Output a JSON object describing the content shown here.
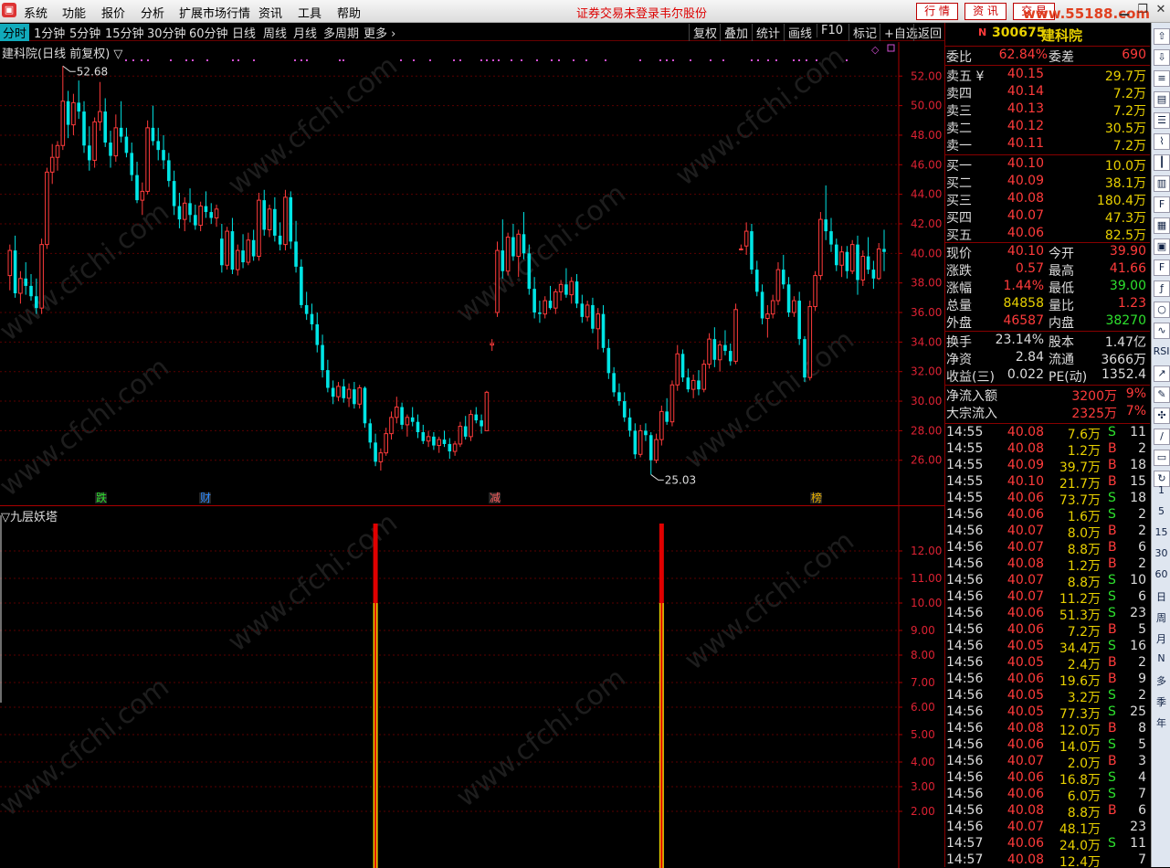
{
  "menu": {
    "items": [
      "系统",
      "功能",
      "报价",
      "分析",
      "扩展市场行情",
      "资讯",
      "工具",
      "帮助"
    ],
    "warning": "证券交易未登录",
    "broker": "韦尔股份",
    "tabs": [
      "行 情",
      "资 讯",
      "交 易"
    ],
    "watermark_site": "www.55188.com"
  },
  "periods": {
    "items": [
      "分时",
      "1分钟",
      "5分钟",
      "15分钟",
      "30分钟",
      "60分钟",
      "日线",
      "周线",
      "月线",
      "多周期",
      "更多 ›"
    ],
    "active": "分时",
    "right": [
      "复权",
      "叠加",
      "统计",
      "画线",
      "F10",
      "标记",
      "+自选",
      "返回"
    ]
  },
  "main_chart": {
    "title": "建科院(日线 前复权) ▽",
    "high_label": "52.68",
    "low_label": "25.03",
    "events": [
      "跌",
      "财",
      "减",
      "榜"
    ],
    "y_ticks": [
      "52.00",
      "50.00",
      "48.00",
      "46.00",
      "44.00",
      "42.00",
      "40.00",
      "38.00",
      "36.00",
      "34.00",
      "32.00",
      "30.00",
      "28.00",
      "26.00"
    ]
  },
  "indicator": {
    "title": "▽九层妖塔",
    "y_ticks": [
      "12.00",
      "11.00",
      "10.00",
      "9.00",
      "8.00",
      "7.00",
      "6.00",
      "5.00",
      "4.00",
      "3.00",
      "2.00"
    ]
  },
  "chart_data": {
    "type": "candlestick",
    "title": "建科院(日线 前复权)",
    "ylim": [
      24.5,
      53.5
    ],
    "grid": true,
    "annotations": {
      "high": 52.68,
      "low": 25.03
    },
    "candles": [
      [
        38.5,
        40.6,
        37.5,
        40.2
      ],
      [
        40.2,
        41.2,
        37.0,
        37.3
      ],
      [
        37.3,
        38.8,
        36.6,
        38.3
      ],
      [
        38.3,
        39.4,
        37.2,
        37.8
      ],
      [
        37.8,
        38.6,
        36.8,
        37.1
      ],
      [
        37.1,
        38.3,
        35.9,
        36.3
      ],
      [
        36.3,
        41.0,
        35.9,
        40.6
      ],
      [
        40.6,
        45.8,
        40.3,
        45.5
      ],
      [
        45.5,
        47.4,
        44.7,
        46.5
      ],
      [
        46.5,
        47.6,
        45.6,
        47.3
      ],
      [
        47.3,
        52.68,
        47.0,
        50.3
      ],
      [
        50.3,
        51.0,
        47.8,
        48.7
      ],
      [
        48.7,
        50.8,
        48.0,
        50.2
      ],
      [
        50.2,
        51.7,
        49.1,
        49.6
      ],
      [
        49.6,
        50.3,
        46.8,
        47.3
      ],
      [
        47.3,
        48.6,
        45.6,
        46.3
      ],
      [
        46.3,
        49.2,
        45.8,
        48.9
      ],
      [
        48.9,
        51.6,
        48.3,
        49.6
      ],
      [
        49.6,
        50.5,
        47.2,
        47.5
      ],
      [
        47.5,
        48.3,
        45.8,
        46.6
      ],
      [
        46.6,
        49.4,
        46.2,
        48.5
      ],
      [
        48.5,
        50.3,
        47.5,
        47.9
      ],
      [
        47.9,
        48.5,
        46.5,
        46.8
      ],
      [
        46.8,
        47.5,
        44.9,
        45.3
      ],
      [
        45.3,
        46.2,
        43.4,
        43.6
      ],
      [
        43.6,
        44.8,
        42.6,
        44.2
      ],
      [
        44.2,
        49.0,
        44.0,
        48.5
      ],
      [
        48.5,
        50.0,
        47.3,
        47.6
      ],
      [
        47.6,
        48.5,
        46.3,
        47.0
      ],
      [
        47.0,
        48.0,
        45.7,
        46.3
      ],
      [
        46.3,
        46.8,
        44.5,
        44.9
      ],
      [
        44.9,
        45.6,
        42.6,
        43.2
      ],
      [
        43.2,
        44.1,
        41.7,
        42.3
      ],
      [
        42.3,
        43.8,
        41.5,
        43.4
      ],
      [
        43.4,
        44.4,
        42.1,
        42.6
      ],
      [
        42.6,
        43.3,
        41.6,
        41.9
      ],
      [
        41.9,
        43.5,
        41.5,
        43.2
      ],
      [
        43.2,
        44.2,
        42.4,
        42.8
      ],
      [
        42.8,
        43.4,
        42.0,
        42.4
      ],
      [
        42.4,
        43.3,
        41.8,
        43.0
      ],
      [
        41.0,
        42.0,
        38.7,
        39.2
      ],
      [
        39.2,
        41.8,
        38.9,
        41.5
      ],
      [
        41.5,
        42.4,
        38.6,
        38.9
      ],
      [
        38.9,
        40.6,
        38.5,
        40.2
      ],
      [
        40.2,
        41.3,
        39.0,
        39.4
      ],
      [
        39.4,
        41.4,
        39.2,
        40.9
      ],
      [
        40.9,
        41.6,
        39.5,
        39.8
      ],
      [
        39.8,
        44.1,
        39.5,
        43.6
      ],
      [
        43.6,
        44.3,
        41.2,
        41.6
      ],
      [
        41.6,
        43.3,
        41.1,
        43.0
      ],
      [
        43.0,
        43.8,
        40.8,
        41.2
      ],
      [
        41.2,
        42.1,
        40.2,
        40.6
      ],
      [
        40.6,
        44.3,
        40.2,
        43.8
      ],
      [
        43.8,
        44.2,
        40.3,
        40.8
      ],
      [
        40.8,
        42.2,
        38.7,
        39.1
      ],
      [
        39.1,
        39.6,
        36.3,
        36.5
      ],
      [
        36.5,
        37.4,
        35.5,
        35.9
      ],
      [
        35.9,
        36.6,
        34.8,
        35.2
      ],
      [
        35.2,
        36.0,
        33.3,
        33.8
      ],
      [
        33.8,
        34.5,
        31.6,
        32.1
      ],
      [
        32.1,
        32.8,
        30.6,
        30.9
      ],
      [
        30.9,
        31.4,
        29.8,
        30.3
      ],
      [
        30.3,
        31.3,
        30.0,
        31.0
      ],
      [
        31.0,
        31.5,
        29.9,
        30.2
      ],
      [
        30.2,
        31.2,
        29.6,
        30.8
      ],
      [
        30.8,
        31.3,
        29.5,
        29.8
      ],
      [
        29.8,
        31.1,
        29.5,
        30.9
      ],
      [
        30.9,
        31.0,
        28.2,
        28.5
      ],
      [
        28.5,
        28.8,
        26.8,
        27.2
      ],
      [
        27.2,
        27.8,
        25.6,
        25.9
      ],
      [
        25.9,
        26.8,
        25.3,
        26.5
      ],
      [
        26.5,
        28.2,
        26.3,
        27.8
      ],
      [
        27.8,
        29.3,
        27.4,
        28.9
      ],
      [
        28.9,
        30.3,
        28.5,
        29.6
      ],
      [
        29.6,
        29.9,
        28.1,
        28.4
      ],
      [
        28.4,
        29.1,
        27.6,
        28.9
      ],
      [
        28.9,
        29.6,
        28.3,
        28.6
      ],
      [
        28.6,
        29.1,
        27.5,
        27.9
      ],
      [
        27.9,
        28.4,
        27.1,
        27.3
      ],
      [
        27.3,
        28.0,
        26.9,
        27.6
      ],
      [
        27.6,
        27.9,
        26.7,
        27.0
      ],
      [
        27.0,
        27.6,
        26.5,
        27.4
      ],
      [
        27.4,
        28.0,
        26.9,
        27.1
      ],
      [
        27.1,
        27.5,
        26.1,
        26.6
      ],
      [
        26.6,
        27.3,
        26.3,
        27.1
      ],
      [
        27.1,
        28.6,
        26.9,
        28.3
      ],
      [
        28.3,
        29.0,
        27.4,
        27.6
      ],
      [
        27.6,
        29.4,
        27.3,
        29.1
      ],
      [
        29.1,
        29.6,
        28.5,
        28.7
      ],
      [
        28.7,
        29.1,
        27.8,
        28.3
      ],
      [
        28.0,
        30.7,
        28.1,
        30.6
      ],
      [
        33.8,
        34.2,
        33.4,
        33.9
      ],
      [
        36.0,
        40.8,
        35.7,
        40.2
      ],
      [
        40.2,
        42.3,
        38.3,
        38.8
      ],
      [
        38.8,
        41.4,
        38.5,
        41.1
      ],
      [
        41.1,
        42.0,
        39.5,
        39.8
      ],
      [
        39.8,
        41.6,
        38.4,
        41.3
      ],
      [
        41.3,
        42.8,
        39.6,
        40.0
      ],
      [
        40.0,
        40.6,
        37.2,
        37.6
      ],
      [
        37.6,
        38.4,
        35.6,
        36.0
      ],
      [
        36.0,
        36.8,
        35.3,
        35.9
      ],
      [
        35.9,
        37.1,
        35.6,
        36.8
      ],
      [
        36.8,
        37.8,
        36.2,
        36.3
      ],
      [
        36.3,
        37.6,
        35.9,
        37.4
      ],
      [
        37.4,
        38.2,
        36.8,
        37.9
      ],
      [
        37.9,
        39.0,
        37.0,
        37.2
      ],
      [
        37.2,
        38.4,
        36.6,
        38.1
      ],
      [
        38.1,
        38.6,
        36.3,
        36.6
      ],
      [
        36.6,
        37.2,
        35.3,
        35.7
      ],
      [
        35.7,
        36.8,
        35.4,
        36.5
      ],
      [
        36.5,
        37.0,
        34.6,
        34.9
      ],
      [
        34.9,
        36.3,
        33.5,
        35.9
      ],
      [
        35.9,
        36.5,
        33.3,
        33.6
      ],
      [
        33.6,
        34.2,
        31.5,
        31.9
      ],
      [
        31.9,
        32.3,
        30.3,
        30.6
      ],
      [
        30.6,
        31.2,
        29.7,
        30.0
      ],
      [
        30.0,
        30.6,
        28.6,
        28.9
      ],
      [
        28.9,
        29.5,
        27.6,
        28.0
      ],
      [
        28.0,
        28.5,
        26.1,
        26.4
      ],
      [
        26.4,
        28.4,
        26.2,
        28.0
      ],
      [
        28.0,
        28.5,
        27.3,
        27.7
      ],
      [
        27.7,
        27.9,
        25.03,
        26.0
      ],
      [
        26.0,
        27.8,
        25.8,
        27.4
      ],
      [
        27.4,
        29.7,
        27.0,
        29.3
      ],
      [
        29.3,
        30.2,
        28.4,
        28.6
      ],
      [
        28.6,
        31.4,
        28.3,
        31.1
      ],
      [
        31.1,
        33.8,
        30.7,
        33.2
      ],
      [
        33.2,
        33.5,
        31.3,
        31.6
      ],
      [
        31.6,
        32.2,
        30.6,
        30.8
      ],
      [
        30.8,
        31.8,
        30.2,
        31.4
      ],
      [
        31.4,
        32.1,
        30.4,
        30.8
      ],
      [
        30.8,
        32.8,
        30.6,
        32.5
      ],
      [
        32.5,
        34.6,
        32.2,
        34.2
      ],
      [
        34.2,
        35.0,
        32.3,
        32.8
      ],
      [
        32.8,
        34.1,
        32.0,
        33.8
      ],
      [
        33.8,
        34.8,
        33.1,
        33.4
      ],
      [
        33.4,
        33.9,
        32.4,
        32.7
      ],
      [
        32.7,
        36.6,
        32.5,
        36.2
      ],
      [
        40.3,
        40.6,
        40.2,
        40.3
      ],
      [
        40.5,
        42.1,
        39.9,
        41.5
      ],
      [
        41.5,
        42.0,
        38.6,
        38.9
      ],
      [
        38.9,
        39.5,
        37.1,
        37.4
      ],
      [
        37.4,
        37.9,
        35.2,
        35.6
      ],
      [
        35.6,
        36.5,
        34.3,
        35.9
      ],
      [
        35.9,
        37.2,
        35.6,
        36.8
      ],
      [
        36.8,
        39.4,
        36.5,
        38.9
      ],
      [
        38.9,
        39.9,
        37.6,
        37.9
      ],
      [
        37.9,
        38.4,
        35.7,
        36.0
      ],
      [
        36.0,
        37.1,
        35.7,
        36.8
      ],
      [
        36.8,
        37.4,
        33.8,
        34.2
      ],
      [
        34.2,
        34.4,
        31.3,
        31.6
      ],
      [
        31.6,
        36.8,
        31.4,
        36.4
      ],
      [
        36.4,
        38.8,
        36.1,
        38.5
      ],
      [
        38.5,
        42.8,
        38.2,
        42.3
      ],
      [
        42.3,
        44.6,
        40.9,
        41.5
      ],
      [
        41.5,
        42.4,
        40.1,
        40.6
      ],
      [
        40.6,
        41.0,
        38.8,
        39.2
      ],
      [
        39.2,
        40.5,
        38.4,
        40.1
      ],
      [
        40.1,
        40.5,
        38.3,
        38.8
      ],
      [
        38.8,
        40.9,
        38.6,
        40.6
      ],
      [
        40.6,
        41.2,
        37.2,
        38.2
      ],
      [
        38.2,
        40.2,
        37.8,
        39.8
      ],
      [
        39.8,
        41.1,
        38.6,
        38.9
      ],
      [
        38.9,
        39.5,
        37.6,
        38.3
      ],
      [
        38.3,
        40.7,
        38.2,
        40.3
      ],
      [
        40.3,
        41.6,
        38.8,
        40.1
      ]
    ],
    "indicator_series": {
      "name": "九层妖塔",
      "ylim": [
        0.5,
        13.0
      ],
      "signals": [
        {
          "index": 69,
          "value": 13.0,
          "base": 10.0
        },
        {
          "index": 123,
          "value": 13.0,
          "base": 10.0
        }
      ]
    }
  },
  "quote": {
    "code": "300675",
    "name": "建科院",
    "market_icon": "N",
    "weibi_label": "委比",
    "weibi": "62.84%",
    "weicha_label": "委差",
    "weicha": "690",
    "asks": [
      {
        "label": "卖五 ¥",
        "price": "40.15",
        "vol": "29.7万"
      },
      {
        "label": "卖四",
        "price": "40.14",
        "vol": "7.2万"
      },
      {
        "label": "卖三",
        "price": "40.13",
        "vol": "7.2万"
      },
      {
        "label": "卖二",
        "price": "40.12",
        "vol": "30.5万"
      },
      {
        "label": "卖一",
        "price": "40.11",
        "vol": "7.2万"
      }
    ],
    "bids": [
      {
        "label": "买一",
        "price": "40.10",
        "vol": "10.0万"
      },
      {
        "label": "买二",
        "price": "40.09",
        "vol": "38.1万"
      },
      {
        "label": "买三",
        "price": "40.08",
        "vol": "180.4万"
      },
      {
        "label": "买四",
        "price": "40.07",
        "vol": "47.3万"
      },
      {
        "label": "买五",
        "price": "40.06",
        "vol": "82.5万"
      }
    ],
    "stats": [
      {
        "l1": "现价",
        "v1": "40.10",
        "c1": "red",
        "l2": "今开",
        "v2": "39.90",
        "c2": "red"
      },
      {
        "l1": "涨跌",
        "v1": "0.57",
        "c1": "red",
        "l2": "最高",
        "v2": "41.66",
        "c2": "red"
      },
      {
        "l1": "涨幅",
        "v1": "1.44%",
        "c1": "red",
        "l2": "最低",
        "v2": "39.00",
        "c2": "grn"
      },
      {
        "l1": "总量",
        "v1": "84858",
        "c1": "yel",
        "l2": "量比",
        "v2": "1.23",
        "c2": "red"
      },
      {
        "l1": "外盘",
        "v1": "46587",
        "c1": "red",
        "l2": "内盘",
        "v2": "38270",
        "c2": "grn"
      }
    ],
    "fund": [
      {
        "l1": "换手",
        "v1": "23.14%",
        "l2": "股本",
        "v2": "1.47亿"
      },
      {
        "l1": "净资",
        "v1": "2.84",
        "l2": "流通",
        "v2": "3666万"
      },
      {
        "l1": "收益(三)",
        "v1": "0.022",
        "l2": "PE(动)",
        "v2": "1352.4"
      }
    ],
    "flows": [
      {
        "label": "净流入额",
        "value": "3200万",
        "pct": "9%"
      },
      {
        "label": "大宗流入",
        "value": "2325万",
        "pct": "7%"
      }
    ]
  },
  "ticks": [
    {
      "t": "14:55",
      "p": "40.08",
      "v": "7.6万",
      "s": "S",
      "n": "11"
    },
    {
      "t": "14:55",
      "p": "40.08",
      "v": "1.2万",
      "s": "B",
      "n": "2"
    },
    {
      "t": "14:55",
      "p": "40.09",
      "v": "39.7万",
      "s": "B",
      "n": "18"
    },
    {
      "t": "14:55",
      "p": "40.10",
      "v": "21.7万",
      "s": "B",
      "n": "15"
    },
    {
      "t": "14:55",
      "p": "40.06",
      "v": "73.7万",
      "s": "S",
      "n": "18"
    },
    {
      "t": "14:56",
      "p": "40.06",
      "v": "1.6万",
      "s": "S",
      "n": "2"
    },
    {
      "t": "14:56",
      "p": "40.07",
      "v": "8.0万",
      "s": "B",
      "n": "2"
    },
    {
      "t": "14:56",
      "p": "40.07",
      "v": "8.8万",
      "s": "B",
      "n": "6"
    },
    {
      "t": "14:56",
      "p": "40.08",
      "v": "1.2万",
      "s": "B",
      "n": "2"
    },
    {
      "t": "14:56",
      "p": "40.07",
      "v": "8.8万",
      "s": "S",
      "n": "10"
    },
    {
      "t": "14:56",
      "p": "40.07",
      "v": "11.2万",
      "s": "S",
      "n": "6"
    },
    {
      "t": "14:56",
      "p": "40.06",
      "v": "51.3万",
      "s": "S",
      "n": "23"
    },
    {
      "t": "14:56",
      "p": "40.06",
      "v": "7.2万",
      "s": "B",
      "n": "5"
    },
    {
      "t": "14:56",
      "p": "40.05",
      "v": "34.4万",
      "s": "S",
      "n": "16"
    },
    {
      "t": "14:56",
      "p": "40.05",
      "v": "2.4万",
      "s": "B",
      "n": "2"
    },
    {
      "t": "14:56",
      "p": "40.06",
      "v": "19.6万",
      "s": "B",
      "n": "9"
    },
    {
      "t": "14:56",
      "p": "40.05",
      "v": "3.2万",
      "s": "S",
      "n": "2"
    },
    {
      "t": "14:56",
      "p": "40.05",
      "v": "77.3万",
      "s": "S",
      "n": "25"
    },
    {
      "t": "14:56",
      "p": "40.08",
      "v": "12.0万",
      "s": "B",
      "n": "8"
    },
    {
      "t": "14:56",
      "p": "40.06",
      "v": "14.0万",
      "s": "S",
      "n": "5"
    },
    {
      "t": "14:56",
      "p": "40.07",
      "v": "2.0万",
      "s": "B",
      "n": "3"
    },
    {
      "t": "14:56",
      "p": "40.06",
      "v": "16.8万",
      "s": "S",
      "n": "4"
    },
    {
      "t": "14:56",
      "p": "40.06",
      "v": "6.0万",
      "s": "S",
      "n": "7"
    },
    {
      "t": "14:56",
      "p": "40.08",
      "v": "8.8万",
      "s": "B",
      "n": "6"
    },
    {
      "t": "14:56",
      "p": "40.07",
      "v": "48.1万",
      "s": "",
      "n": "23"
    },
    {
      "t": "14:57",
      "p": "40.06",
      "v": "24.0万",
      "s": "S",
      "n": "11"
    },
    {
      "t": "14:57",
      "p": "40.08",
      "v": "12.4万",
      "s": "",
      "n": "7"
    }
  ],
  "toolbar": {
    "icons": [
      "arrow-up-icon",
      "arrow-down-icon",
      "list-icon",
      "chart-icon",
      "report-icon",
      "line-chart-icon",
      "candle-icon",
      "book-icon",
      "f10-icon",
      "table-icon",
      "grid-icon",
      "f12-icon",
      "f-icon",
      "circle-icon",
      "trend-icon"
    ],
    "labels": [
      "RSI",
      "1",
      "5",
      "15",
      "30",
      "60",
      "日",
      "周",
      "月",
      "N",
      "多",
      "季",
      "年"
    ]
  },
  "colors": {
    "up": "#ff3b3b",
    "down": "#00e5e5",
    "grid": "#5a0000",
    "axis": "#d23",
    "signal_yellow": "#e8d000"
  }
}
